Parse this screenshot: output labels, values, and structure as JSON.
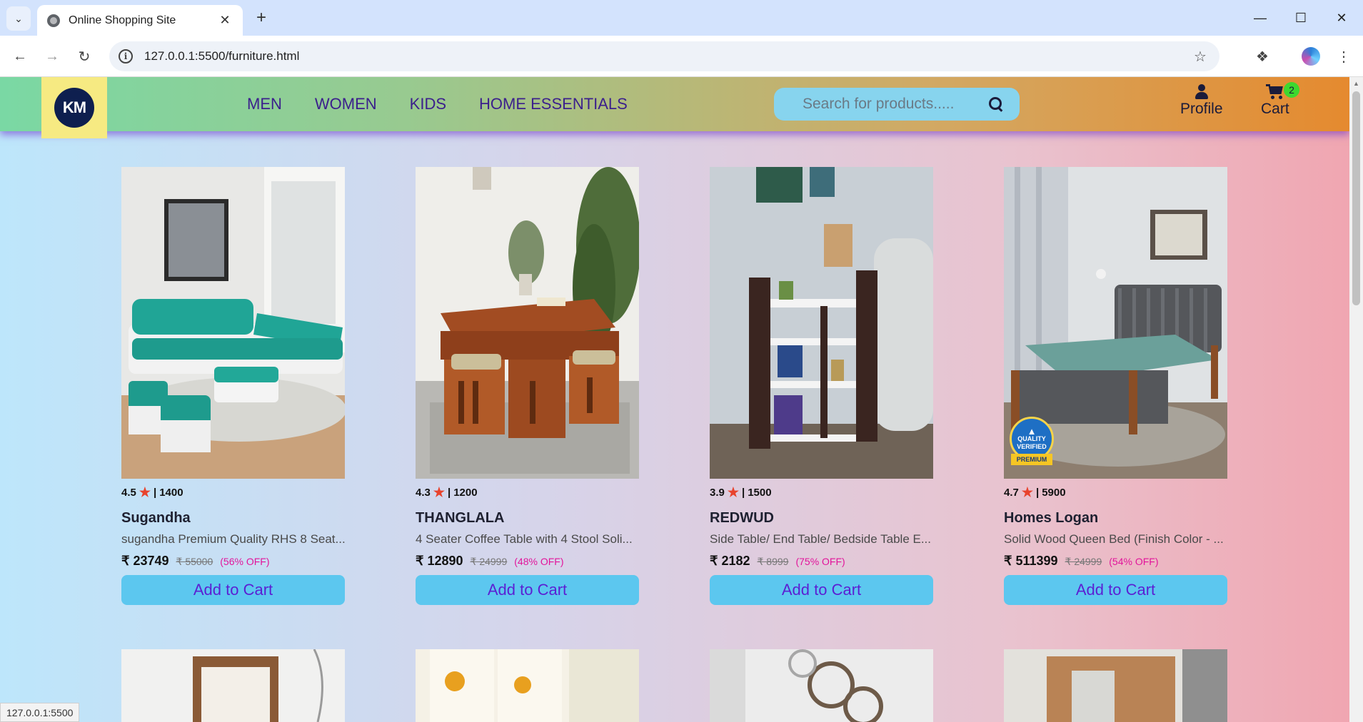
{
  "browser": {
    "tab_title": "Online Shopping Site",
    "url": "127.0.0.1:5500/furniture.html",
    "status_url": "127.0.0.1:5500"
  },
  "header": {
    "logo_text": "KM",
    "nav": [
      "MEN",
      "WOMEN",
      "KIDS",
      "HOME ESSENTIALS"
    ],
    "search_placeholder": "Search for products.....",
    "profile_label": "Profile",
    "cart_label": "Cart",
    "cart_count": "2"
  },
  "products": [
    {
      "rating": "4.5",
      "reviews": "1400",
      "brand": "Sugandha",
      "desc": "sugandha Premium Quality RHS 8 Seat...",
      "price": "₹ 23749",
      "mrp": "₹ 55000",
      "off": "(56% OFF)",
      "button": "Add to Cart"
    },
    {
      "rating": "4.3",
      "reviews": "1200",
      "brand": "THANGLALA",
      "desc": "4 Seater Coffee Table with 4 Stool Soli...",
      "price": "₹ 12890",
      "mrp": "₹ 24999",
      "off": "(48% OFF)",
      "button": "Add to Cart"
    },
    {
      "rating": "3.9",
      "reviews": "1500",
      "brand": "REDWUD",
      "desc": "Side Table/ End Table/ Bedside Table E...",
      "price": "₹ 2182",
      "mrp": "₹ 8999",
      "off": "(75% OFF)",
      "button": "Add to Cart"
    },
    {
      "rating": "4.7",
      "reviews": "5900",
      "brand": "Homes Logan",
      "desc": "Solid Wood Queen Bed (Finish Color - ...",
      "price": "₹ 511399",
      "mrp": "₹ 24999",
      "off": "(54% OFF)",
      "button": "Add to Cart"
    }
  ],
  "badge": {
    "line1": "QUALITY",
    "line2": "VERIFIED",
    "line3": "PREMIUM"
  }
}
